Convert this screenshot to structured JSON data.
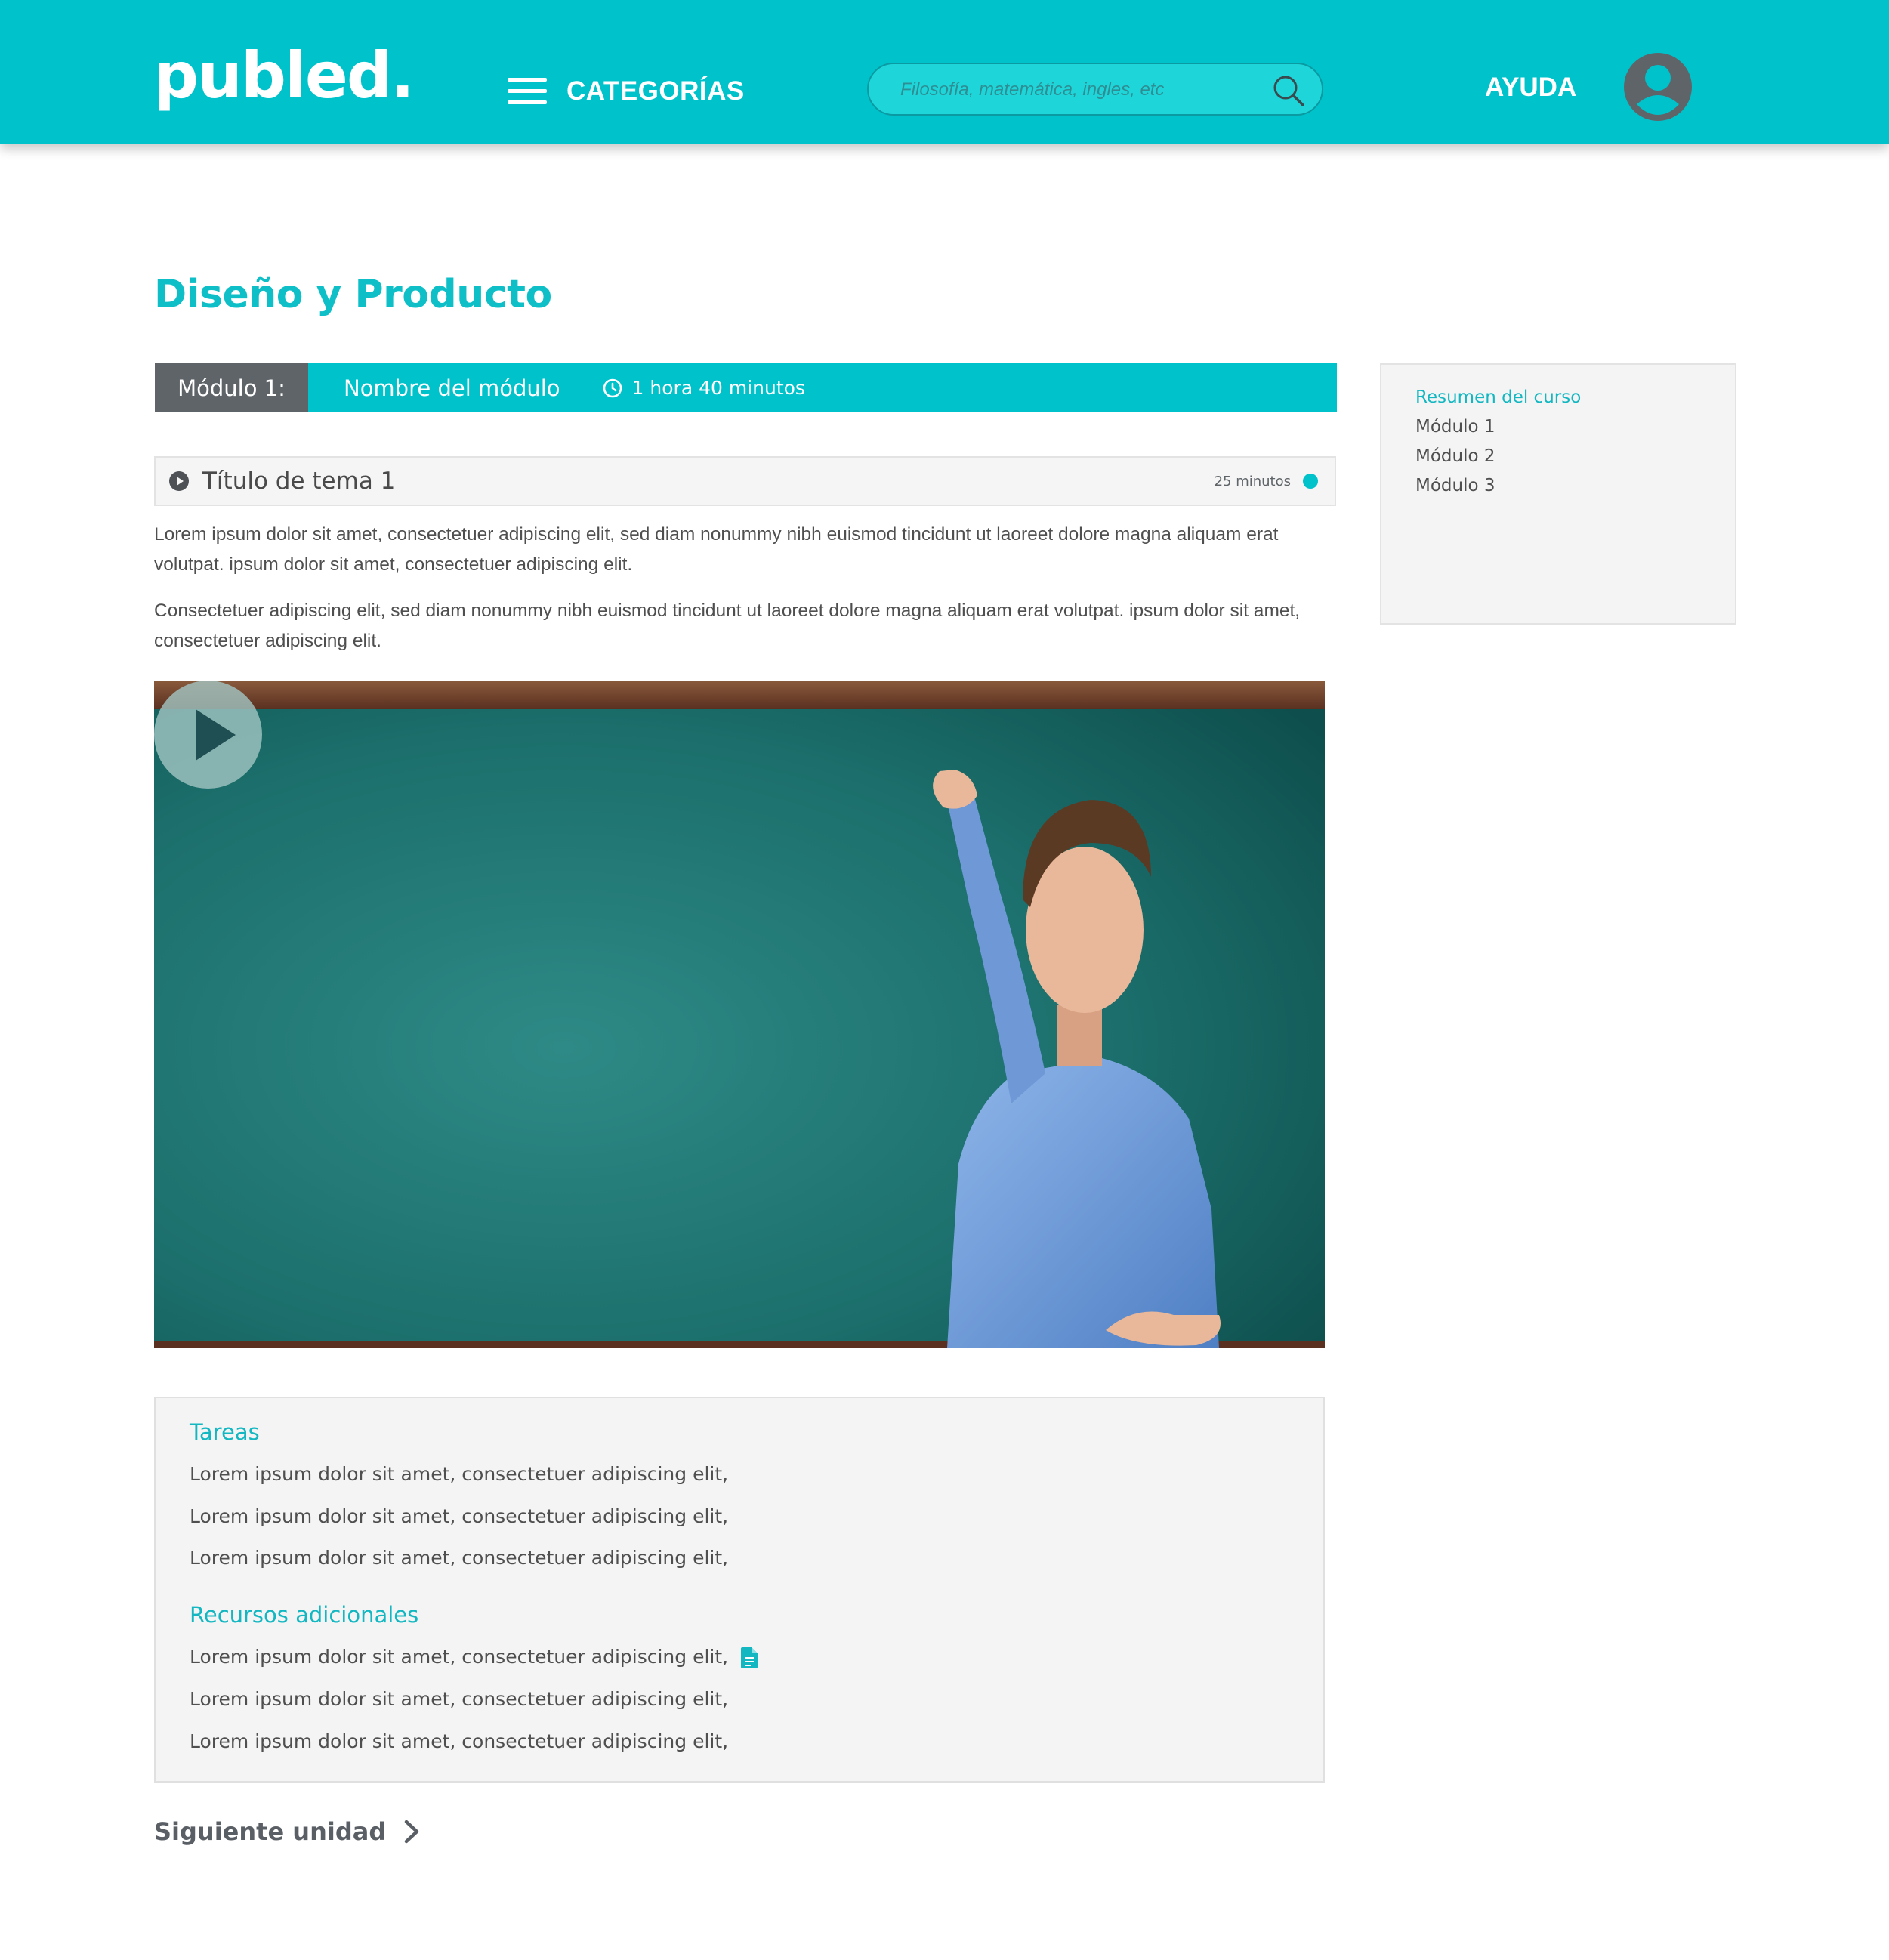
{
  "header": {
    "logo": "publed.",
    "categories_label": "CATEGORÍAS",
    "search_placeholder": "Filosofía, matemática, ingles, etc",
    "help_label": "AYUDA"
  },
  "page_title": "Diseño y Producto",
  "module": {
    "number_label": "Módulo 1:",
    "name": "Nombre del módulo",
    "duration": "1 hora 40 minutos"
  },
  "topic": {
    "title": "Título de tema 1",
    "duration": "25 minutos"
  },
  "paragraphs": [
    "Lorem ipsum dolor sit amet, consectetuer adipiscing elit, sed diam nonummy nibh euismod tincidunt ut laoreet dolore magna aliquam erat volutpat. ipsum dolor sit amet, consectetuer adipiscing elit.",
    "Consectetuer adipiscing elit, sed diam nonummy nibh euismod tincidunt ut laoreet dolore magna aliquam erat volutpat. ipsum dolor sit amet, consectetuer adipiscing elit."
  ],
  "tasks": {
    "heading": "Tareas",
    "items": [
      "Lorem ipsum dolor sit amet, consectetuer adipiscing elit,",
      "Lorem ipsum dolor sit amet, consectetuer adipiscing elit,",
      "Lorem ipsum dolor sit amet, consectetuer adipiscing elit,"
    ]
  },
  "resources": {
    "heading": "Recursos adicionales",
    "items": [
      "Lorem ipsum dolor sit amet, consectetuer adipiscing elit,",
      "Lorem ipsum dolor sit amet, consectetuer adipiscing elit,",
      "Lorem ipsum dolor sit amet, consectetuer adipiscing elit,"
    ]
  },
  "next_unit_label": "Siguiente unidad",
  "sidebar": {
    "items": [
      {
        "label": "Resumen del curso",
        "active": true
      },
      {
        "label": "Módulo 1",
        "active": false
      },
      {
        "label": "Módulo 2",
        "active": false
      },
      {
        "label": "Módulo 3",
        "active": false
      }
    ]
  },
  "colors": {
    "brand": "#00c2cb",
    "module_label_bg": "#5f6469",
    "panel_bg": "#f4f4f4",
    "text": "#4f4f4f"
  },
  "icons": [
    "hamburger-icon",
    "search-icon",
    "avatar-icon",
    "clock-icon",
    "play-icon",
    "status-dot",
    "document-icon",
    "chevron-right-icon"
  ]
}
